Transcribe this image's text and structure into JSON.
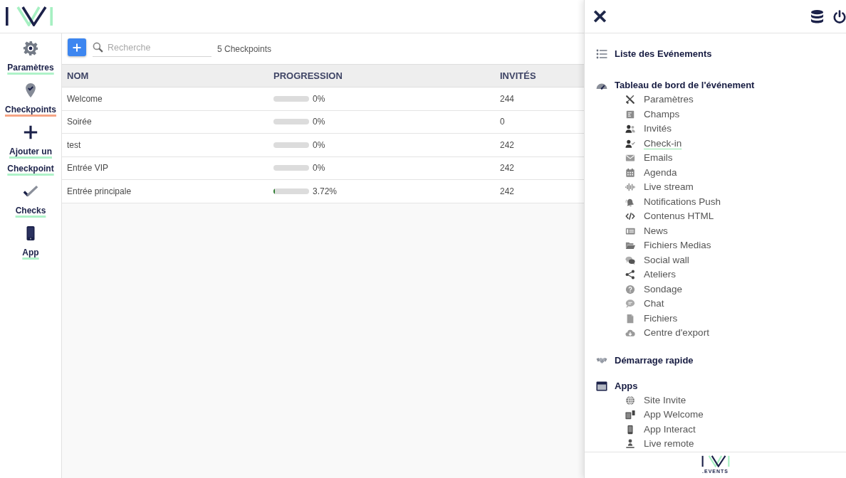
{
  "sidebar": {
    "items": [
      {
        "label": "Paramètres",
        "selected": false
      },
      {
        "label": "Checkpoints",
        "selected": true
      },
      {
        "label": "Ajouter un Checkpoint",
        "selected": false
      },
      {
        "label": "Checks",
        "selected": false
      },
      {
        "label": "App",
        "selected": false
      }
    ]
  },
  "toolbar": {
    "search": {
      "placeholder": "Recherche"
    },
    "count": "5 Checkpoints"
  },
  "table": {
    "columns": [
      "NOM",
      "PROGRESSION",
      "INVITÉS"
    ],
    "rows": [
      {
        "name": "Welcome",
        "level": 0,
        "progress": "0%",
        "invites": "244"
      },
      {
        "name": "Soirée",
        "level": 0,
        "progress": "0%",
        "invites": "0"
      },
      {
        "name": "test",
        "level": 0,
        "progress": "0%",
        "invites": "242"
      },
      {
        "name": "Entrée VIP",
        "level": 0,
        "progress": "0%",
        "invites": "242"
      },
      {
        "name": "Entrée principale",
        "level": 0.0372,
        "progress": "3.72%",
        "invites": "242"
      }
    ]
  },
  "panel": {
    "sections": [
      {
        "title": "Liste des Evénements"
      },
      {
        "title": "Tableau de bord de l'événement",
        "items": [
          {
            "label": "Paramètres",
            "selected": false
          },
          {
            "label": "Champs",
            "selected": false
          },
          {
            "label": "Invités",
            "selected": false
          },
          {
            "label": "Check-in",
            "selected": true
          },
          {
            "label": "Emails",
            "selected": false
          },
          {
            "label": "Agenda",
            "selected": false
          },
          {
            "label": "Live stream",
            "selected": false
          },
          {
            "label": "Notifications Push",
            "selected": false
          },
          {
            "label": "Contenus HTML",
            "selected": false
          },
          {
            "label": "News",
            "selected": false
          },
          {
            "label": "Fichiers Medias",
            "selected": false
          },
          {
            "label": "Social wall",
            "selected": false
          },
          {
            "label": "Ateliers",
            "selected": false
          },
          {
            "label": "Sondage",
            "selected": false
          },
          {
            "label": "Chat",
            "selected": false
          },
          {
            "label": "Fichiers",
            "selected": false
          },
          {
            "label": "Centre d'export",
            "selected": false
          }
        ]
      },
      {
        "title": "Démarrage rapide"
      },
      {
        "title": "Apps",
        "items": [
          {
            "label": "Site Invite",
            "selected": false
          },
          {
            "label": "App Welcome",
            "selected": false
          },
          {
            "label": "App Interact",
            "selected": false
          },
          {
            "label": "Live remote",
            "selected": false
          }
        ]
      }
    ]
  },
  "footer": {
    "logo_caption": ".EVENTS"
  }
}
